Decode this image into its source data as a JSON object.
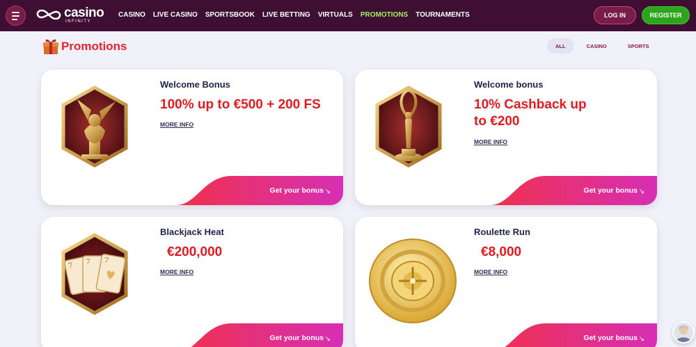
{
  "header": {
    "logo": {
      "word": "casino",
      "sub": "INFINITY"
    },
    "nav": [
      {
        "label": "CASINO",
        "active": false
      },
      {
        "label": "LIVE CASINO",
        "active": false
      },
      {
        "label": "SPORTSBOOK",
        "active": false
      },
      {
        "label": "LIVE BETTING",
        "active": false
      },
      {
        "label": "VIRTUALS",
        "active": false
      },
      {
        "label": "PROMOTIONS",
        "active": true
      },
      {
        "label": "TOURNAMENTS",
        "active": false
      }
    ],
    "login_label": "LOG IN",
    "register_label": "REGISTER"
  },
  "page": {
    "title": "Promotions",
    "filters": [
      {
        "label": "ALL",
        "active": true
      },
      {
        "label": "CASINO",
        "active": false
      },
      {
        "label": "SPORTS",
        "active": false
      }
    ]
  },
  "promotions": [
    {
      "title": "Welcome Bonus",
      "value_lines": [
        "100% up to €500 + 200 FS"
      ],
      "more_info": "MORE INFO",
      "cta": "Get your bonus",
      "art": "winged-lion-trophy-icon"
    },
    {
      "title": "Welcome bonus",
      "value_lines": [
        "10% Cashback up",
        "to €200"
      ],
      "more_info": "MORE INFO",
      "cta": "Get your bonus",
      "art": "award-statue-icon"
    },
    {
      "title": "Blackjack Heat",
      "value_lines": [
        "€200,000"
      ],
      "more_info": "MORE INFO",
      "cta": "Get your bonus",
      "art": "playing-cards-icon"
    },
    {
      "title": "Roulette Run",
      "value_lines": [
        "€8,000"
      ],
      "more_info": "MORE INFO",
      "cta": "Get your bonus",
      "art": "roulette-wheel-icon"
    }
  ],
  "colors": {
    "header_bg": "#3e0f33",
    "accent_red": "#e21b23",
    "active_nav": "#a4f05a",
    "register_green": "#2ca41b",
    "cta_gradient_start": "#f0304c",
    "cta_gradient_end": "#d62fb5"
  }
}
